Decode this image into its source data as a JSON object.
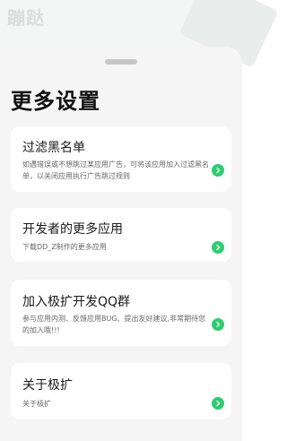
{
  "app": {
    "title": "蹦跶"
  },
  "page": {
    "title": "更多设置"
  },
  "colors": {
    "accent": "#2ecc71",
    "background": "#f5f5f5",
    "card": "#ffffff"
  },
  "cards": [
    {
      "title": "过滤黑名单",
      "desc": "如遇错误或不想跳过某应用广告，可将该应用加入过滤黑名单，以关闭应用执行广告跳过规则",
      "icon": "chevron-right-icon"
    },
    {
      "title": "开发者的更多应用",
      "desc": "下载DD_Z制作的更多应用",
      "icon": "chevron-right-icon"
    },
    {
      "title": "加入极扩开发QQ群",
      "desc": "参与应用内测、反馈应用BUG、提出友好建议,非常期待您的加入哦!!!",
      "icon": "chevron-right-icon"
    },
    {
      "title": "关于极扩",
      "desc": "关于极扩",
      "icon": "chevron-right-icon"
    }
  ]
}
